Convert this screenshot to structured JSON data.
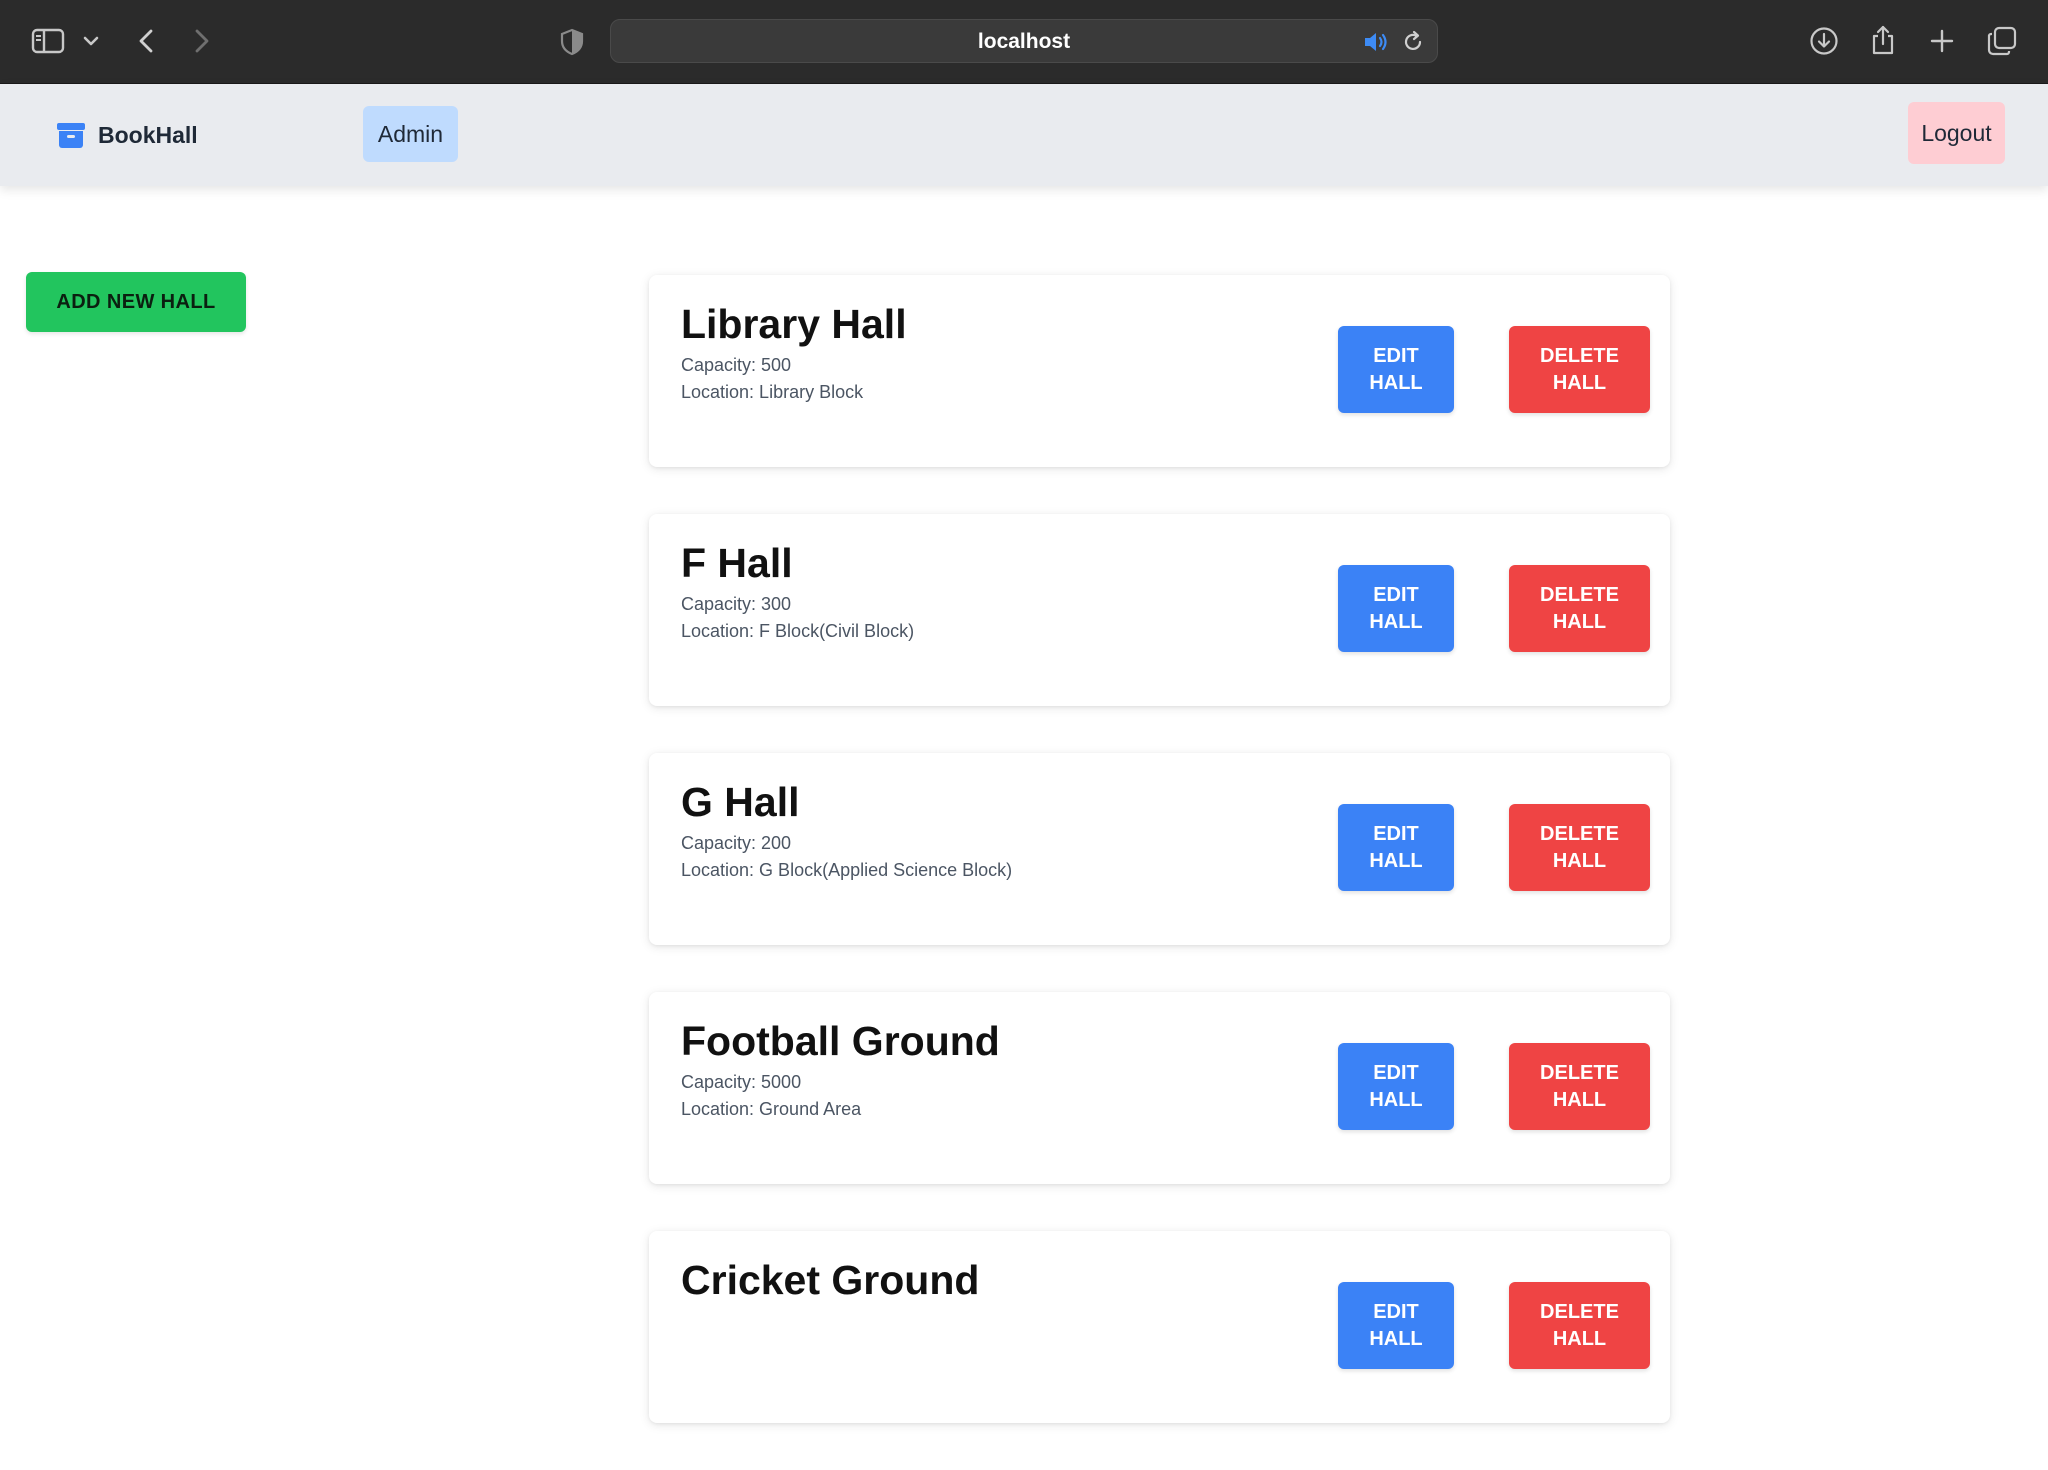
{
  "browser": {
    "address": "localhost",
    "icons": {
      "sidebar": "sidebar-icon",
      "back": "chevron-left-icon",
      "forward": "chevron-right-icon",
      "shield": "shield-icon",
      "audio": "speaker-icon",
      "reload": "reload-icon",
      "download": "download-icon",
      "share": "share-icon",
      "new_tab": "plus-icon",
      "tabs": "tab-overview-icon"
    },
    "audio_color": "#3d8bf5"
  },
  "navbar": {
    "brand": "BookHall",
    "admin_label": "Admin",
    "logout_label": "Logout",
    "colors": {
      "admin_bg": "#bfdbfe",
      "logout_bg": "#fecdd3",
      "brand_icon": "#3b82f6"
    }
  },
  "actions": {
    "add_hall_label": "ADD NEW HALL",
    "edit_label": "EDIT HALL",
    "delete_label": "DELETE HALL",
    "colors": {
      "add": "#22c55e",
      "edit": "#3b82f6",
      "delete": "#ef4444"
    }
  },
  "halls": [
    {
      "name": "Library Hall",
      "capacity": "Capacity: 500",
      "location": "Location: Library Block"
    },
    {
      "name": "F Hall",
      "capacity": "Capacity: 300",
      "location": "Location: F Block(Civil Block)"
    },
    {
      "name": "G Hall",
      "capacity": "Capacity: 200",
      "location": "Location: G Block(Applied Science Block)"
    },
    {
      "name": "Football Ground",
      "capacity": "Capacity: 5000",
      "location": "Location: Ground Area"
    },
    {
      "name": "Cricket Ground",
      "capacity": "",
      "location": ""
    }
  ]
}
